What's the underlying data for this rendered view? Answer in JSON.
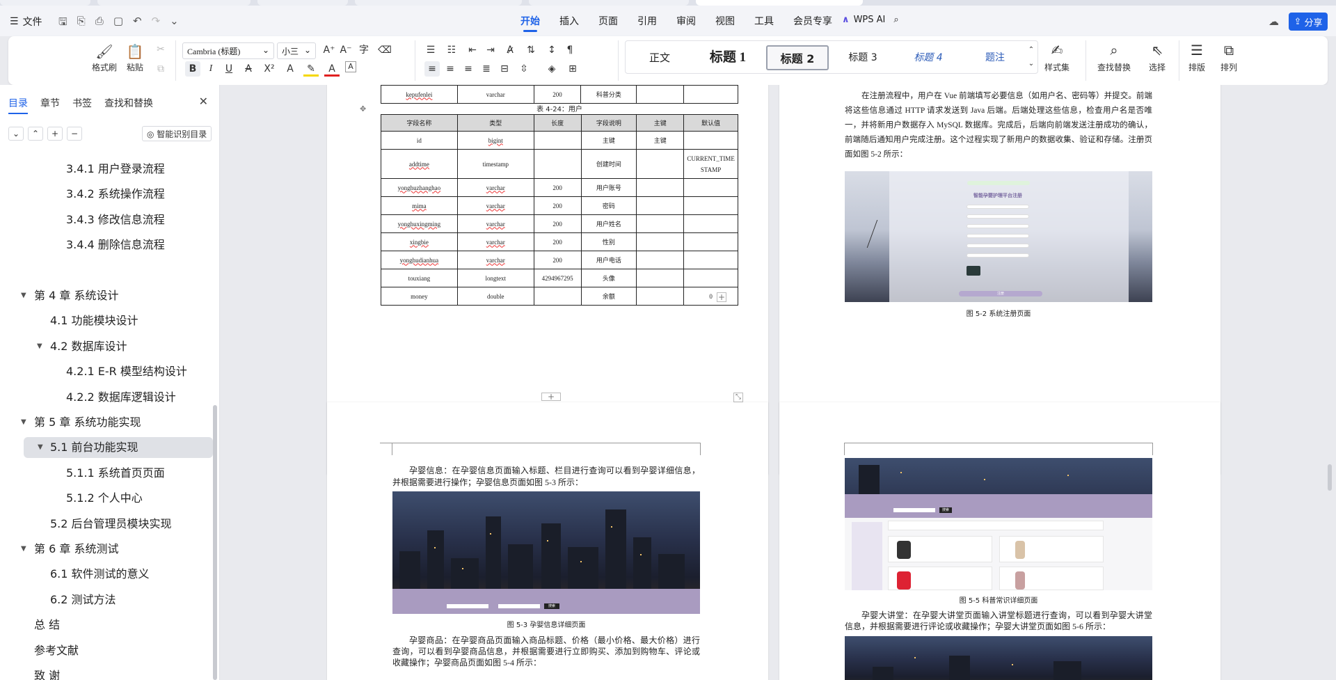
{
  "menubar": {
    "file_label": "文件",
    "menus": [
      "开始",
      "插入",
      "页面",
      "引用",
      "审阅",
      "视图",
      "工具",
      "会员专享"
    ],
    "active_menu": "开始",
    "wps_ai": "WPS AI",
    "share": "分享"
  },
  "ribbon": {
    "format_painter": "格式刷",
    "paste": "粘贴",
    "font_name": "Cambria (标题)",
    "font_size": "小三",
    "styles": [
      "正文",
      "标题 1",
      "标题 2",
      "标题 3",
      "标题 4",
      "题注"
    ],
    "selected_style": "标题 2",
    "style_set": "样式集",
    "find_replace": "查找替换",
    "select": "选择",
    "typeset": "排版",
    "arrange": "排列"
  },
  "sidebar": {
    "tabs": [
      "目录",
      "章节",
      "书签",
      "查找和替换"
    ],
    "smart_toc": "智能识别目录",
    "toc": [
      {
        "label": "3.4.1  用户登录流程",
        "level": 3
      },
      {
        "label": "3.4.2  系统操作流程",
        "level": 3
      },
      {
        "label": "3.4.3 修改信息流程",
        "level": 3
      },
      {
        "label": "3.4.4 删除信息流程",
        "level": 3
      },
      {
        "label": "第 4 章  系统设计",
        "level": 1
      },
      {
        "label": "4.1  功能模块设计",
        "level": 2
      },
      {
        "label": "4.2  数据库设计",
        "level": 2
      },
      {
        "label": "4.2.1 E-R 模型结构设计",
        "level": 3
      },
      {
        "label": "4.2.2  数据库逻辑设计",
        "level": 3
      },
      {
        "label": "第 5 章  系统功能实现",
        "level": 1
      },
      {
        "label": "5.1 前台功能实现",
        "level": 2
      },
      {
        "label": "5.1.1 系统首页页面",
        "level": 3
      },
      {
        "label": "5.1.2 个人中心",
        "level": 3
      },
      {
        "label": "5.2 后台管理员模块实现",
        "level": 2
      },
      {
        "label": "第 6 章  系统测试",
        "level": 1
      },
      {
        "label": "6.1  软件测试的意义",
        "level": 2
      },
      {
        "label": "6.2  测试方法",
        "level": 2
      },
      {
        "label": "总 结",
        "level": 1
      },
      {
        "label": "参考文献",
        "level": 1
      },
      {
        "label": "致 谢",
        "level": 1
      }
    ]
  },
  "page1": {
    "top_row": [
      "kepufenlei",
      "varchar",
      "200",
      "科普分类",
      "",
      ""
    ],
    "table_caption": "表 4-24：用户",
    "headers": [
      "字段名称",
      "类型",
      "长度",
      "字段说明",
      "主键",
      "默认值"
    ],
    "rows": [
      [
        "id",
        "bigint",
        "",
        "主键",
        "主键",
        ""
      ],
      [
        "addtime",
        "timestamp",
        "",
        "创建时间",
        "",
        "CURRENT_TIMESTAMP"
      ],
      [
        "yonghuzhanghao",
        "varchar",
        "200",
        "用户账号",
        "",
        ""
      ],
      [
        "mima",
        "varchar",
        "200",
        "密码",
        "",
        ""
      ],
      [
        "yonghuxingming",
        "varchar",
        "200",
        "用户姓名",
        "",
        ""
      ],
      [
        "xingbie",
        "varchar",
        "200",
        "性别",
        "",
        ""
      ],
      [
        "yonghudianhua",
        "varchar",
        "200",
        "用户电话",
        "",
        ""
      ],
      [
        "touxiang",
        "longtext",
        "4294967295",
        "头像",
        "",
        ""
      ],
      [
        "money",
        "double",
        "",
        "余额",
        "",
        "0"
      ]
    ]
  },
  "page2": {
    "para": "在注册流程中，用户在 Vue 前端填写必要信息（如用户名、密码等）并提交。前端将这些信息通过 HTTP 请求发送到 Java 后端。后端处理这些信息，检查用户名是否唯一，并将新用户数据存入 MySQL 数据库。完成后，后端向前端发送注册成功的确认，前端随后通知用户完成注册。这个过程实现了新用户的数据收集、验证和存储。注册页面如图 5-2 所示：",
    "form_title": "智能孕婴护理平台注册",
    "form_button": "注册",
    "caption": "图 5-2 系统注册页面"
  },
  "page3": {
    "para1": "孕婴信息：在孕婴信息页面输入标题、栏目进行查询可以看到孕婴详细信息，并根据需要进行操作；孕婴信息页面如图 5-3 所示：",
    "caption": "图 5-3 孕婴信息详细页面",
    "para2": "孕婴商品：在孕婴商品页面输入商品标题、价格（最小价格、最大价格）进行查询，可以看到孕婴商品信息，并根据需要进行立即购买、添加到购物车、评论或收藏操作；孕婴商品页面如图 5-4 所示："
  },
  "page4": {
    "caption": "图 5-5 科普常识详细页面",
    "para": "孕婴大讲堂：在孕婴大讲堂页面输入讲堂标题进行查询，可以看到孕婴大讲堂信息，并根据需要进行评论或收藏操作；孕婴大讲堂页面如图 5-6 所示：",
    "search_button": "搜索"
  }
}
